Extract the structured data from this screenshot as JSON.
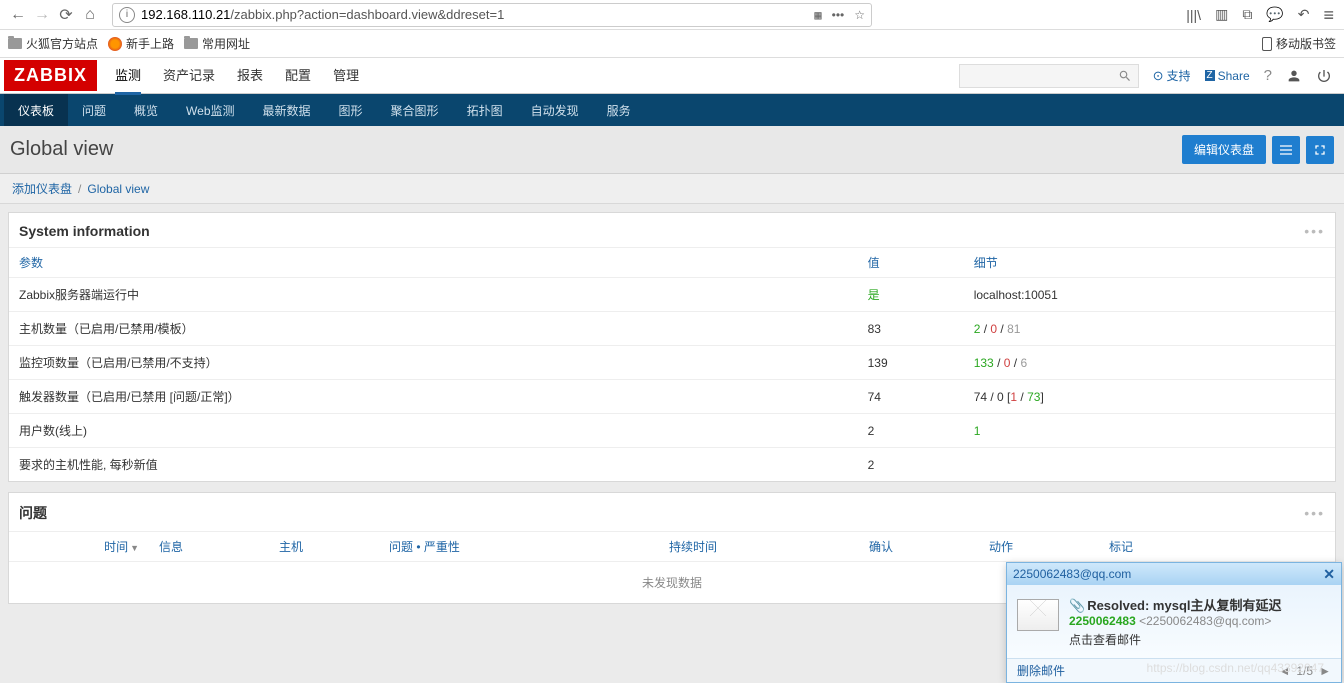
{
  "browser": {
    "url_prefix": "192.168.110.21",
    "url_rest": "/zabbix.php?action=dashboard.view&ddreset=1",
    "bookmarks": [
      "火狐官方站点",
      "新手上路",
      "常用网址"
    ],
    "mobile_link": "移动版书签"
  },
  "header": {
    "logo": "ZABBIX",
    "main_nav": [
      "监测",
      "资产记录",
      "报表",
      "配置",
      "管理"
    ],
    "main_nav_active": 0,
    "support": "支持",
    "share": "Share"
  },
  "subnav": {
    "items": [
      "仪表板",
      "问题",
      "概览",
      "Web监测",
      "最新数据",
      "图形",
      "聚合图形",
      "拓扑图",
      "自动发现",
      "服务"
    ],
    "active": 0
  },
  "page": {
    "title": "Global view",
    "edit_btn": "编辑仪表盘",
    "breadcrumb_add": "添加仪表盘",
    "breadcrumb_current": "Global view"
  },
  "sysinfo": {
    "title": "System information",
    "headers": {
      "param": "参数",
      "value": "值",
      "detail": "细节"
    },
    "rows": [
      {
        "param": "Zabbix服务器端运行中",
        "value_html": "<span class='g'>是</span>",
        "detail_html": "localhost:10051"
      },
      {
        "param": "主机数量（已启用/已禁用/模板）",
        "value_html": "83",
        "detail_html": "<span class='g'>2</span> / <span class='r'>0</span> / <span class='gy'>81</span>"
      },
      {
        "param": "监控项数量（已启用/已禁用/不支持）",
        "value_html": "139",
        "detail_html": "<span class='g'>133</span> / <span class='r'>0</span> / <span class='gy'>6</span>"
      },
      {
        "param": "触发器数量（已启用/已禁用 [问题/正常]）",
        "value_html": "74",
        "detail_html": "74 / 0 [<span class='r'>1</span> / <span class='g'>73</span>]"
      },
      {
        "param": "用户数(线上)",
        "value_html": "2",
        "detail_html": "<span class='g'>1</span>"
      },
      {
        "param": "要求的主机性能, 每秒新值",
        "value_html": "2",
        "detail_html": ""
      }
    ]
  },
  "problems": {
    "title": "问题",
    "columns": [
      "时间",
      "信息",
      "主机",
      "问题 • 严重性",
      "持续时间",
      "确认",
      "动作",
      "标记"
    ],
    "no_data": "未发现数据"
  },
  "mail": {
    "title_email": "2250062483@qq.com",
    "subject": "Resolved: mysql主从复制有延迟",
    "from_name": "2250062483",
    "from_addr": "<2250062483@qq.com>",
    "hint": "点击查看邮件",
    "delete": "删除邮件",
    "page": "1/5"
  },
  "watermark": "https://blog.csdn.net/qq43392047"
}
